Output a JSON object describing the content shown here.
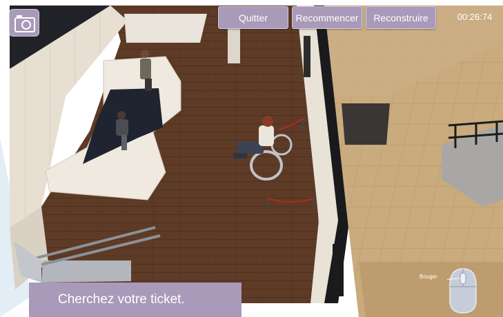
{
  "toolbar": {
    "quit_label": "Quitter",
    "restart_label": "Recommencer",
    "rebuild_label": "Reconstruire"
  },
  "timer": "00:26:74",
  "camera_icon": "camera-icon",
  "instruction": "Cherchez votre ticket.",
  "controls": {
    "move_label": "Bouger",
    "mouse_icon": "mouse-icon"
  },
  "colors": {
    "ui_panel": "#a89ab8",
    "floor": "#5e3b26",
    "outdoor_pavement": "#c8aa7c",
    "counter": "#ece6dc",
    "rope": "#b02a1e"
  }
}
